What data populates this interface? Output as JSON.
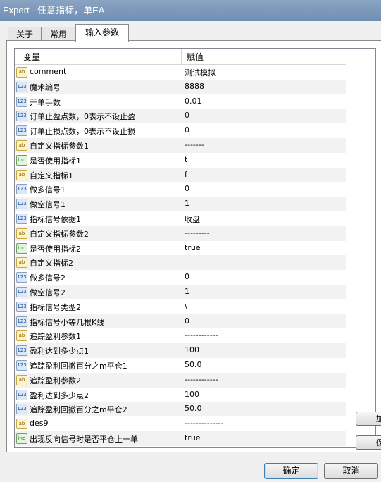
{
  "window": {
    "title": "Expert - 任意指标，单EA"
  },
  "tabs": [
    {
      "label": "关于"
    },
    {
      "label": "常用"
    },
    {
      "label": "输入参数"
    }
  ],
  "grid": {
    "col_variable": "变量",
    "col_value": "赋值",
    "rows": [
      {
        "icon": "ab",
        "name": "comment",
        "value": "测试模拟"
      },
      {
        "icon": "123",
        "name": "魔术编号",
        "value": "8888"
      },
      {
        "icon": "123",
        "name": "开单手数",
        "value": "0.01"
      },
      {
        "icon": "123",
        "name": "订单止盈点数，0表示不设止盈",
        "value": "0"
      },
      {
        "icon": "123",
        "name": "订单止损点数，0表示不设止损",
        "value": "0"
      },
      {
        "icon": "ab",
        "name": "自定义指标参数1",
        "value": "-------"
      },
      {
        "icon": "ind",
        "name": "是否使用指标1",
        "value": "t"
      },
      {
        "icon": "ab",
        "name": "自定义指标1",
        "value": "f"
      },
      {
        "icon": "123",
        "name": "做多信号1",
        "value": "0"
      },
      {
        "icon": "123",
        "name": "做空信号1",
        "value": "1"
      },
      {
        "icon": "123",
        "name": "指标信号依据1",
        "value": "收盘"
      },
      {
        "icon": "ab",
        "name": "自定义指标参数2",
        "value": "---------"
      },
      {
        "icon": "ind",
        "name": "是否使用指标2",
        "value": "true"
      },
      {
        "icon": "ab",
        "name": "自定义指标2",
        "value": ""
      },
      {
        "icon": "123",
        "name": "做多信号2",
        "value": "0"
      },
      {
        "icon": "123",
        "name": "做空信号2",
        "value": "1"
      },
      {
        "icon": "123",
        "name": "指标信号类型2",
        "value": "\\"
      },
      {
        "icon": "123",
        "name": "指标信号小等几根K线",
        "value": "0"
      },
      {
        "icon": "ab",
        "name": "追踪盈利参数1",
        "value": "------------"
      },
      {
        "icon": "123",
        "name": "盈利达到多少点1",
        "value": "100"
      },
      {
        "icon": "123",
        "name": "追踪盈利回撤百分之m平仓1",
        "value": "50.0"
      },
      {
        "icon": "ab",
        "name": "追踪盈利参数2",
        "value": "------------"
      },
      {
        "icon": "123",
        "name": "盈利达到多少点2",
        "value": "100"
      },
      {
        "icon": "123",
        "name": "追踪盈利回撤百分之m平仓2",
        "value": "50.0"
      },
      {
        "icon": "ab",
        "name": "des9",
        "value": "--------------"
      },
      {
        "icon": "ind",
        "name": "出现反向信号时是否平仓上一单",
        "value": "true"
      }
    ]
  },
  "side_buttons": [
    {
      "label": "加"
    },
    {
      "label": "保"
    }
  ],
  "buttons": {
    "ok": "确定",
    "cancel": "取消"
  }
}
